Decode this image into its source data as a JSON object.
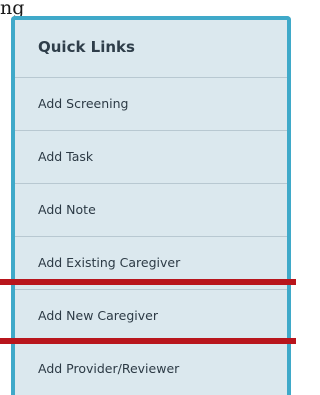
{
  "top_text": "ng",
  "quick_links": {
    "title": "Quick Links",
    "items": [
      {
        "label": "Add Screening"
      },
      {
        "label": "Add Task"
      },
      {
        "label": "Add Note"
      },
      {
        "label": "Add Existing Caregiver"
      },
      {
        "label": "Add New Caregiver"
      },
      {
        "label": "Add Provider/Reviewer"
      }
    ]
  },
  "colors": {
    "panel_border": "#3fa9c9",
    "panel_background": "#dbe8ee",
    "highlight": "#b8151c"
  }
}
